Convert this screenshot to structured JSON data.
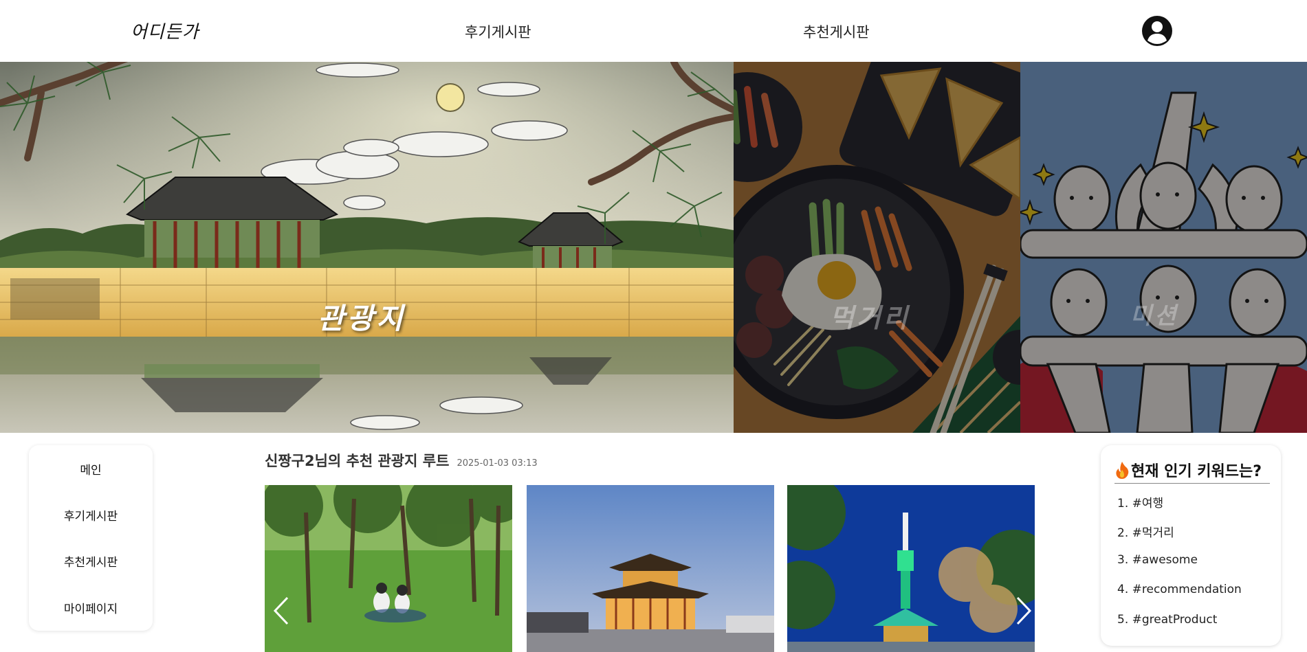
{
  "header": {
    "logo": "어디든가",
    "nav": {
      "review_board": "후기게시판",
      "recommend_board": "추천게시판"
    },
    "profile_icon": "user-circle-icon"
  },
  "hero": {
    "panels": [
      {
        "label": "관광지"
      },
      {
        "label": "먹거리"
      },
      {
        "label": "미션"
      }
    ]
  },
  "sidebar": {
    "items": [
      {
        "label": "메인"
      },
      {
        "label": "후기게시판"
      },
      {
        "label": "추천게시판"
      },
      {
        "label": "마이페이지"
      }
    ]
  },
  "post": {
    "title": "신짱구2님의 추천 관광지 루트",
    "date": "2025-01-03 03:13",
    "prev_icon": "chevron-left-icon",
    "next_icon": "chevron-right-icon"
  },
  "keywords": {
    "title": "현재 인기 키워드는?",
    "icon": "fire-icon",
    "items": [
      {
        "label": "1. #여행"
      },
      {
        "label": "2. #먹거리"
      },
      {
        "label": "3. #awesome"
      },
      {
        "label": "4. #recommendation"
      },
      {
        "label": "5. #greatProduct"
      }
    ]
  }
}
